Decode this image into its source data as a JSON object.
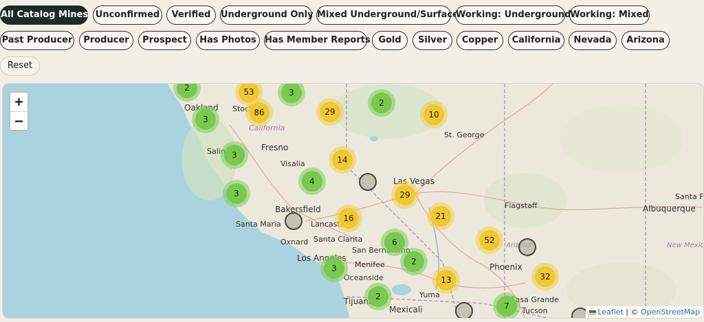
{
  "filters": {
    "row1": [
      "All Catalog Mines",
      "Unconfirmed",
      "Verified",
      "Underground Only",
      "Mixed Underground/Surface",
      "Working: Underground",
      "Working: Mixed"
    ],
    "row2": [
      "Past Producer",
      "Producer",
      "Prospect",
      "Has Photos",
      "Has Member Reports",
      "Gold",
      "Silver",
      "Copper",
      "California",
      "Nevada",
      "Arizona"
    ],
    "reset": "Reset",
    "active": "All Catalog Mines"
  },
  "map": {
    "zoom_in": "+",
    "zoom_out": "−",
    "places": [
      "Oakland",
      "Stockton",
      "California",
      "Fresno",
      "Visalia",
      "Salinas",
      "Bakersfield",
      "Santa Maria",
      "Lancaster",
      "Oxnard",
      "Santa Clarita",
      "Los Angeles",
      "San Bernardino",
      "Menifee",
      "Oceanside",
      "Tijuana",
      "Mexicali",
      "Yuma",
      "Las Vegas",
      "St. George",
      "Flagstaff",
      "Phoenix",
      "Casa Grande",
      "Tucson",
      "Albuquerque",
      "New Mexico",
      "Arizona",
      "Santa Fe"
    ],
    "clusters": [
      {
        "count": "2",
        "color": "green"
      },
      {
        "count": "53",
        "color": "yellow"
      },
      {
        "count": "3",
        "color": "green"
      },
      {
        "count": "86",
        "color": "yellow"
      },
      {
        "count": "3",
        "color": "green"
      },
      {
        "count": "29",
        "color": "yellow"
      },
      {
        "count": "2",
        "color": "green"
      },
      {
        "count": "10",
        "color": "yellow"
      },
      {
        "count": "3",
        "color": "green"
      },
      {
        "count": "14",
        "color": "yellow"
      },
      {
        "count": "4",
        "color": "green"
      },
      {
        "count": "3",
        "color": "green"
      },
      {
        "count": "29",
        "color": "yellow"
      },
      {
        "count": "16",
        "color": "yellow"
      },
      {
        "count": "21",
        "color": "yellow"
      },
      {
        "count": "6",
        "color": "green"
      },
      {
        "count": "52",
        "color": "yellow"
      },
      {
        "count": "2",
        "color": "green"
      },
      {
        "count": "3",
        "color": "green"
      },
      {
        "count": "13",
        "color": "yellow"
      },
      {
        "count": "32",
        "color": "yellow"
      },
      {
        "count": "2",
        "color": "green"
      },
      {
        "count": "7",
        "color": "green"
      }
    ],
    "attribution": {
      "leaflet": "Leaflet",
      "sep": " | © ",
      "osm": "OpenStreetMap"
    }
  }
}
